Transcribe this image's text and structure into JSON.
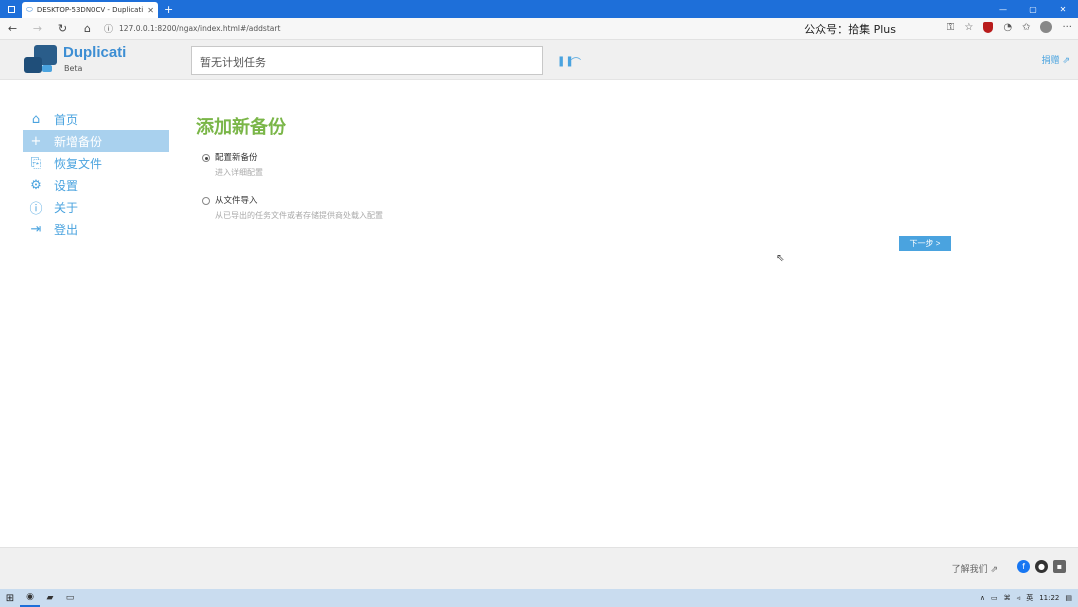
{
  "browser": {
    "tab_title": "DESKTOP-53DN0CV - Duplicati",
    "url": "127.0.0.1:8200/ngax/index.html#/addstart",
    "wechat_text": "公众号：拾集 Plus"
  },
  "header": {
    "brand": "Duplicati",
    "brand_sub": "Beta",
    "status": "暂无计划任务",
    "donate": "捐赠"
  },
  "sidebar": {
    "items": [
      {
        "label": "首页",
        "icon": "home-icon"
      },
      {
        "label": "新增备份",
        "icon": "plus-icon"
      },
      {
        "label": "恢复文件",
        "icon": "restore-icon"
      },
      {
        "label": "设置",
        "icon": "gear-icon"
      },
      {
        "label": "关于",
        "icon": "info-icon"
      },
      {
        "label": "登出",
        "icon": "logout-icon"
      }
    ],
    "active_index": 1
  },
  "main": {
    "title": "添加新备份",
    "options": [
      {
        "label": "配置新备份",
        "desc": "进入详细配置",
        "checked": true
      },
      {
        "label": "从文件导入",
        "desc": "从已导出的任务文件或者存储提供商处载入配置",
        "checked": false
      }
    ],
    "next_label": "下一步 >"
  },
  "footer": {
    "learn": "了解我们"
  },
  "taskbar": {
    "time": "11:22",
    "ime": "英"
  },
  "colors": {
    "accent": "#4aa3df",
    "title_green": "#7ab648",
    "active_nav": "#a9d1ee",
    "titlebar": "#1e6fd9"
  }
}
